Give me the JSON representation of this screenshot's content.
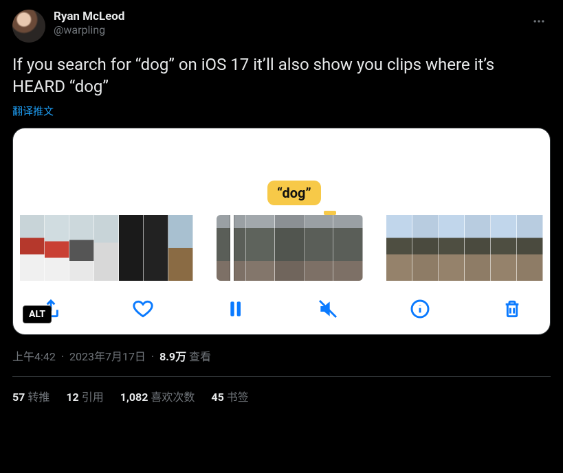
{
  "user": {
    "display_name": "Ryan McLeod",
    "handle": "@warpling"
  },
  "tweet": {
    "text": "If you search for “dog” on iOS 17 it’ll also show you clips where it’s HEARD “dog”",
    "translate_label": "翻译推文"
  },
  "media": {
    "tag_text": "“dog”",
    "alt_badge": "ALT",
    "icons": {
      "share": "share-icon",
      "heart": "heart-icon",
      "pause": "pause-icon",
      "mute": "mute-icon",
      "info": "info-icon",
      "trash": "trash-icon"
    }
  },
  "meta": {
    "time": "上午4:42",
    "date": "2023年7月17日",
    "views_count": "8.9万",
    "views_label": "查看"
  },
  "stats": {
    "retweets": {
      "count": "57",
      "label": "转推"
    },
    "quotes": {
      "count": "12",
      "label": "引用"
    },
    "likes": {
      "count": "1,082",
      "label": "喜欢次数"
    },
    "bookmarks": {
      "count": "45",
      "label": "书签"
    }
  }
}
